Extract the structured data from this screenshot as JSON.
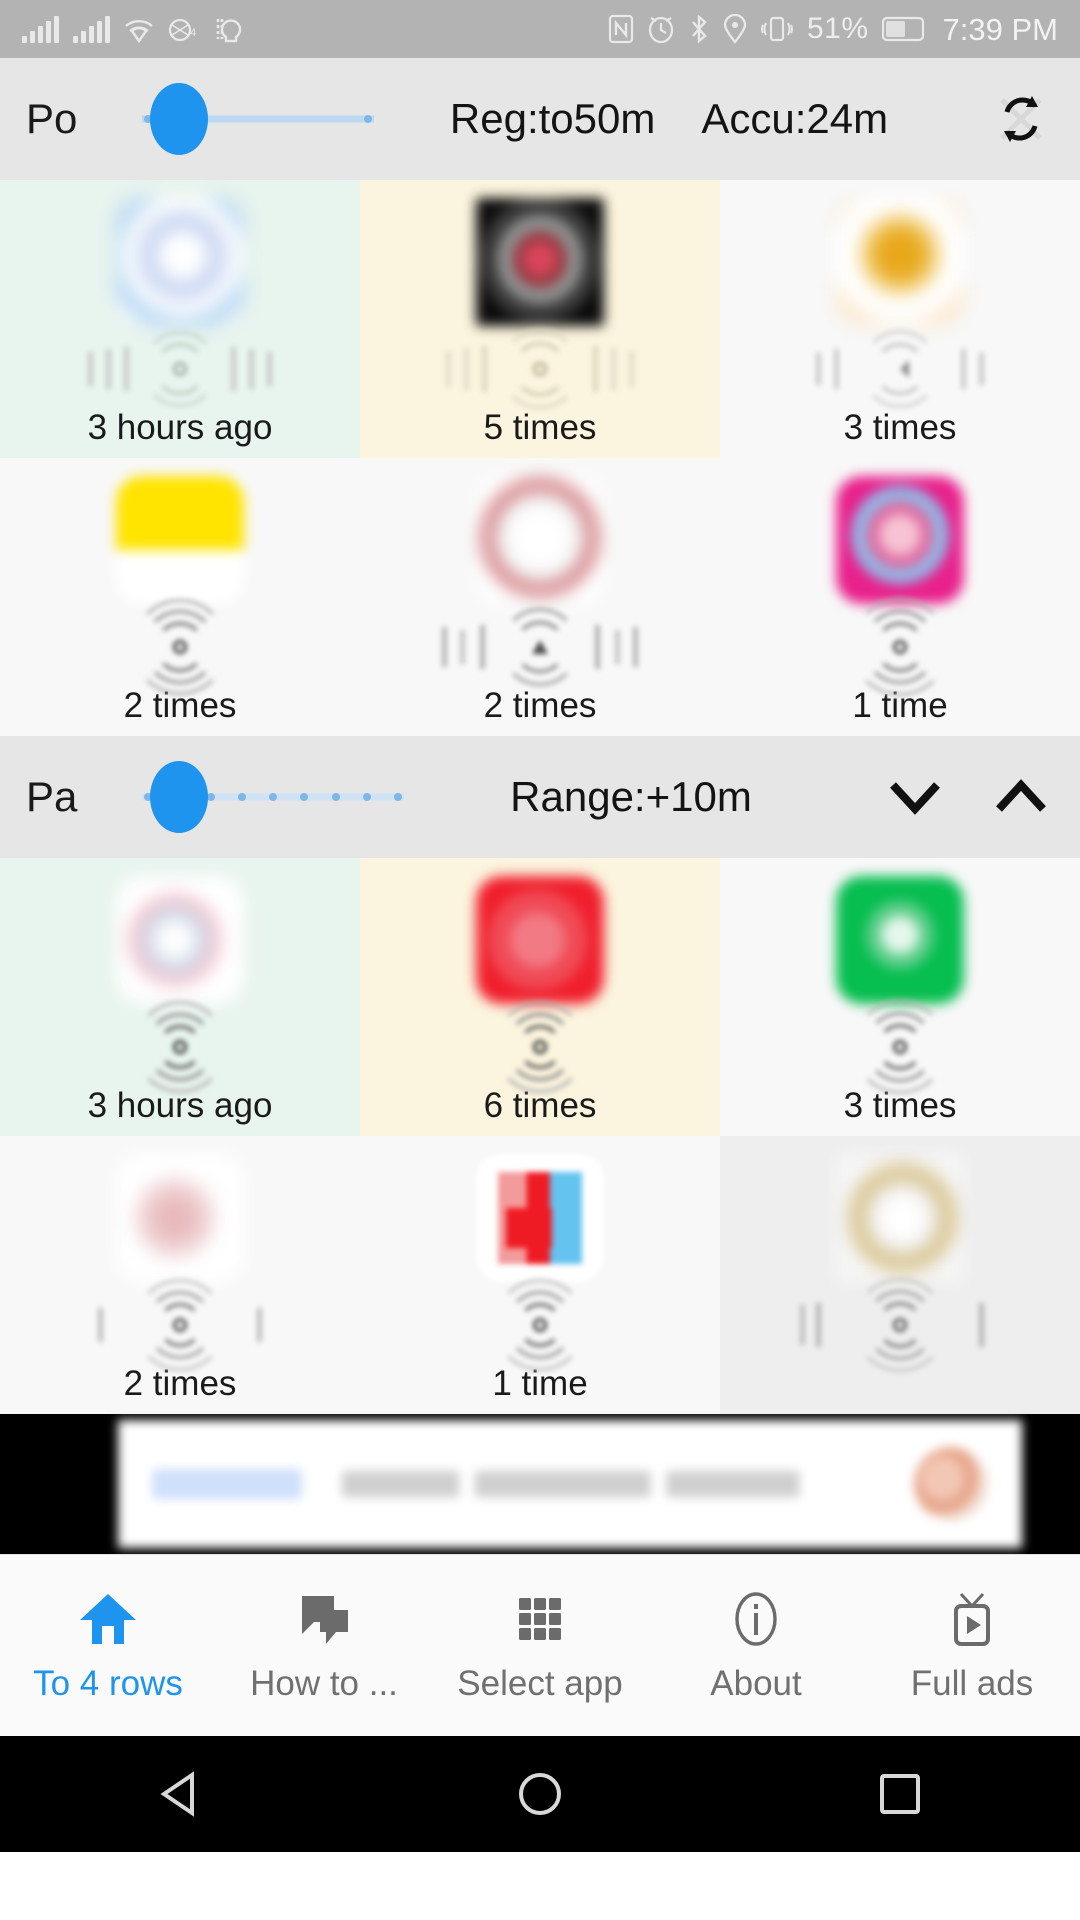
{
  "status_bar": {
    "left_icons": [
      "signal-bars-icon",
      "signal-bars-icon",
      "wifi-icon",
      "data-4g-icon",
      "call-icon"
    ],
    "right_icons": [
      "nfc-icon",
      "alarm-icon",
      "bluetooth-icon",
      "location-icon",
      "vibrate-icon"
    ],
    "battery_percent": "51%",
    "battery_icon": "battery-icon",
    "time": "7:39 PM",
    "background_color": "#b3b3b3",
    "foreground_color": "#e9e9e9"
  },
  "panel_one": {
    "toolbar": {
      "label": "Po",
      "slider": {
        "name": "position-slider",
        "value_percent": 16,
        "tick_count": 2
      },
      "value_one": "Reg:to50m",
      "value_two": "Accu:24m",
      "action_icon": "sync-refresh-icon"
    },
    "cells": [
      {
        "label": "3 hours ago",
        "tint": "tint-green",
        "icon": "app-icon-blurred",
        "wave": "wave-signal-icon"
      },
      {
        "label": "5 times",
        "tint": "tint-cream",
        "icon": "app-icon-blurred",
        "wave": "wave-signal-icon"
      },
      {
        "label": "3 times",
        "tint": "tint-plain",
        "icon": "app-icon-blurred",
        "wave": "wave-signal-icon"
      },
      {
        "label": "2 times",
        "tint": "tint-plain",
        "icon": "app-icon-blurred",
        "wave": "wave-signal-icon"
      },
      {
        "label": "2 times",
        "tint": "tint-plain",
        "icon": "app-icon-blurred",
        "wave": "wave-signal-icon"
      },
      {
        "label": "1 time",
        "tint": "tint-plain",
        "icon": "app-icon-blurred",
        "wave": "wave-signal-icon"
      }
    ]
  },
  "panel_two": {
    "toolbar": {
      "label": "Pa",
      "slider": {
        "name": "range-slider",
        "value_percent": 14,
        "tick_count": 9
      },
      "value_one": "Range:+10m",
      "action_icon_down": "chevron-down-icon",
      "action_icon_up": "chevron-up-icon"
    },
    "cells": [
      {
        "label": "3 hours ago",
        "tint": "tint-green",
        "icon": "app-icon-blurred",
        "wave": "wave-signal-icon"
      },
      {
        "label": "6 times",
        "tint": "tint-cream",
        "icon": "app-icon-blurred",
        "wave": "wave-signal-icon"
      },
      {
        "label": "3 times",
        "tint": "tint-plain",
        "icon": "app-icon-blurred",
        "wave": "wave-signal-icon"
      },
      {
        "label": "2 times",
        "tint": "tint-plain",
        "icon": "app-icon-blurred",
        "wave": "wave-signal-icon"
      },
      {
        "label": "1 time",
        "tint": "tint-plain",
        "icon": "app-icon-blurred",
        "wave": "wave-signal-icon"
      },
      {
        "label": "",
        "tint": "tint-gray",
        "icon": "app-icon-blurred",
        "wave": "wave-signal-icon"
      }
    ]
  },
  "ad_banner": {
    "name": "advertisement-banner",
    "content": "blurred-ad"
  },
  "bottom_nav": {
    "active_color": "#1e94ef",
    "inactive_color": "#707070",
    "items": [
      {
        "label": "To 4 rows",
        "icon": "home-icon",
        "active": true
      },
      {
        "label": "How to ...",
        "icon": "chat-icon",
        "active": false
      },
      {
        "label": "Select app",
        "icon": "grid-apps-icon",
        "active": false
      },
      {
        "label": "About",
        "icon": "info-icon",
        "active": false
      },
      {
        "label": "Full ads",
        "icon": "tv-play-icon",
        "active": false
      }
    ]
  },
  "android_nav": {
    "back": "back-triangle-icon",
    "home": "home-circle-icon",
    "recents": "recents-square-icon"
  }
}
